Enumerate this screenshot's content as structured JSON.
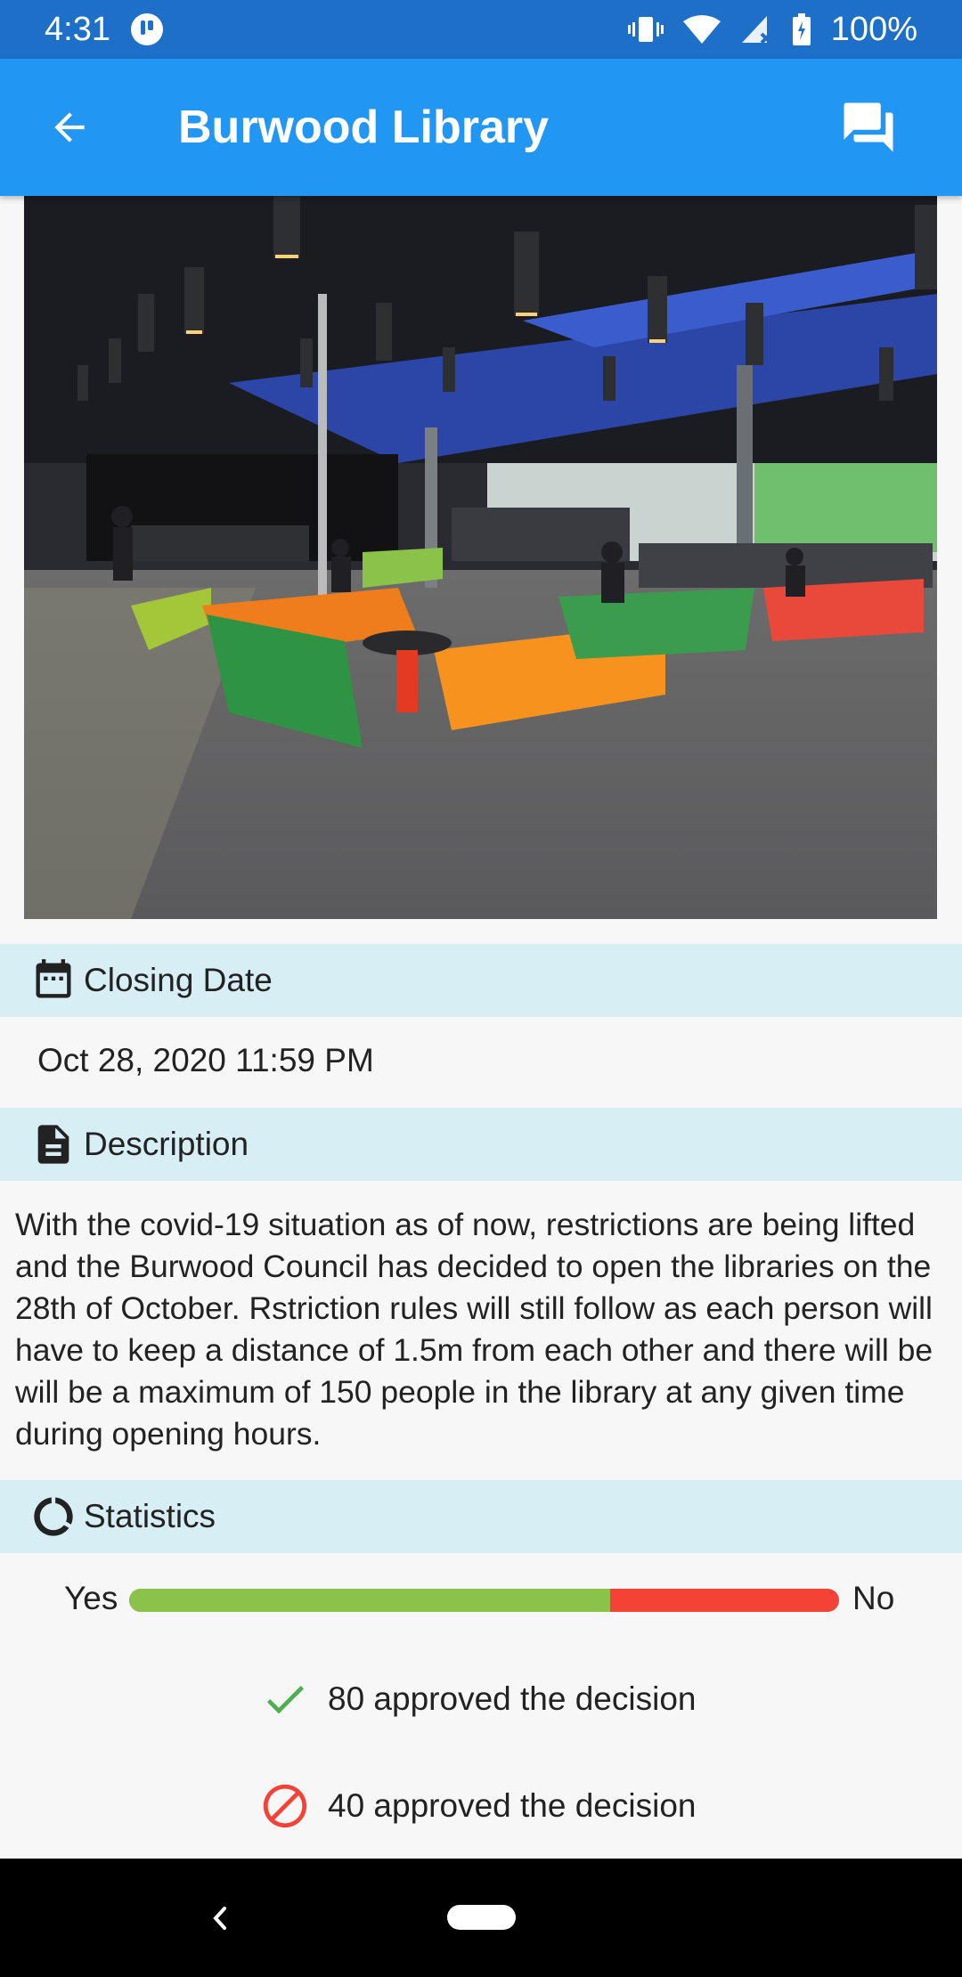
{
  "status_bar": {
    "time": "4:31",
    "battery": "100%"
  },
  "app_bar": {
    "title": "Burwood Library"
  },
  "sections": {
    "closing_date": {
      "label": "Closing Date",
      "value": "Oct 28, 2020 11:59 PM"
    },
    "description": {
      "label": "Description",
      "text": "With the covid-19 situation as of now, restrictions are being lifted and the Burwood Council has decided to open the libraries on the  28th of October. Rstriction rules will still follow as each person  will have to keep a distance of 1.5m from each other and there will be will be a maximum of 150 people in the library at any given time during opening hours."
    },
    "statistics": {
      "label": "Statistics",
      "yes_label": "Yes",
      "no_label": "No",
      "yes_fraction": 0.677,
      "approved_text": "80 approved the decision",
      "rejected_text": "40 approved the decision"
    }
  },
  "colors": {
    "status_bar": "#1e6fc7",
    "app_bar": "#2196f3",
    "section_header": "#d7eef5",
    "yes_bar": "#8bc34a",
    "no_bar": "#f44336",
    "check": "#4caf50",
    "block": "#f44336"
  },
  "icons": {
    "back": "arrow-back-icon",
    "chat": "forum-icon",
    "calendar": "calendar-icon",
    "description": "document-icon",
    "statistics": "donut-chart-icon",
    "approved": "check-icon",
    "rejected": "block-icon"
  }
}
